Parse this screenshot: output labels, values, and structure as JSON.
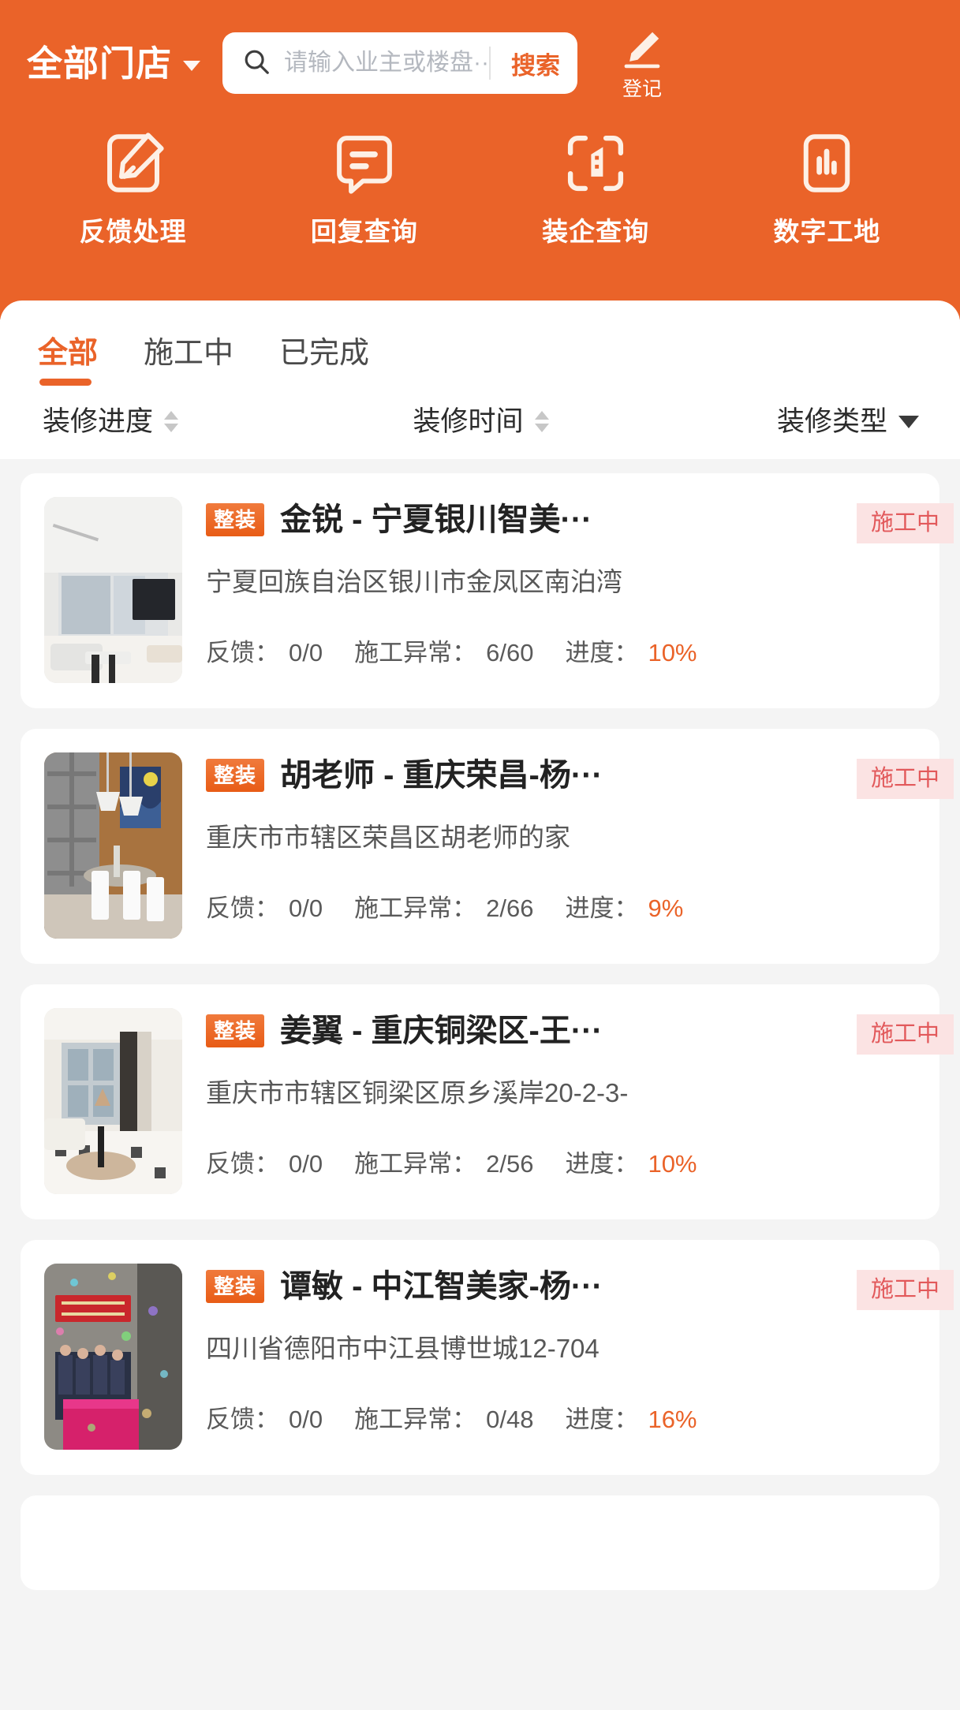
{
  "theme": {
    "brand_orange": "#EA6329",
    "page_bg": "#F4F4F4",
    "status_bg": "#FBE3E3",
    "status_text": "#E2595B"
  },
  "header": {
    "store_selector": {
      "label": "全部门店",
      "icon": "chevron-down-icon"
    },
    "search": {
      "icon": "search-icon",
      "value": "",
      "placeholder": "请输入业主或楼盘···",
      "button_label": "搜索"
    },
    "register": {
      "icon": "pencil-edit-icon",
      "label": "登记"
    }
  },
  "quicknav": [
    {
      "icon": "feedback-edit-icon",
      "label": "反馈处理"
    },
    {
      "icon": "reply-chat-icon",
      "label": "回复查询"
    },
    {
      "icon": "scan-company-icon",
      "label": "装企查询"
    },
    {
      "icon": "chart-bar-icon",
      "label": "数字工地"
    }
  ],
  "tabs": [
    {
      "label": "全部",
      "active": true
    },
    {
      "label": "施工中",
      "active": false
    },
    {
      "label": "已完成",
      "active": false
    }
  ],
  "filters": [
    {
      "label": "装修进度",
      "control": "sort-arrows-icon"
    },
    {
      "label": "装修时间",
      "control": "sort-arrows-icon"
    },
    {
      "label": "装修类型",
      "control": "chevron-down-icon"
    }
  ],
  "stat_labels": {
    "feedback": "反馈：",
    "anomaly": "施工异常：",
    "progress": "进度："
  },
  "cards": [
    {
      "type_tag": "整装",
      "title": "金锐 - 宁夏银川智美···",
      "status": "施工中",
      "address": "宁夏回族自治区银川市金凤区南泊湾",
      "feedback": "0/0",
      "anomaly": "6/60",
      "progress": "10%",
      "thumb": "living-room-white"
    },
    {
      "type_tag": "整装",
      "title": "胡老师 - 重庆荣昌-杨···",
      "status": "施工中",
      "address": "重庆市市辖区荣昌区胡老师的家",
      "feedback": "0/0",
      "anomaly": "2/66",
      "progress": "9%",
      "thumb": "dining-room-orange"
    },
    {
      "type_tag": "整装",
      "title": "姜翼 - 重庆铜梁区-王···",
      "status": "施工中",
      "address": "重庆市市辖区铜梁区原乡溪岸20-2-3-",
      "feedback": "0/0",
      "anomaly": "2/56",
      "progress": "10%",
      "thumb": "living-room-marble"
    },
    {
      "type_tag": "整装",
      "title": "谭敏 - 中江智美家-杨···",
      "status": "施工中",
      "address": "四川省德阳市中江县博世城12-704",
      "feedback": "0/0",
      "anomaly": "0/48",
      "progress": "16%",
      "thumb": "ceremony-photo"
    },
    {
      "type_tag": "",
      "title": "",
      "status": "",
      "address": "",
      "feedback": "",
      "anomaly": "",
      "progress": "",
      "thumb": "partial"
    }
  ]
}
